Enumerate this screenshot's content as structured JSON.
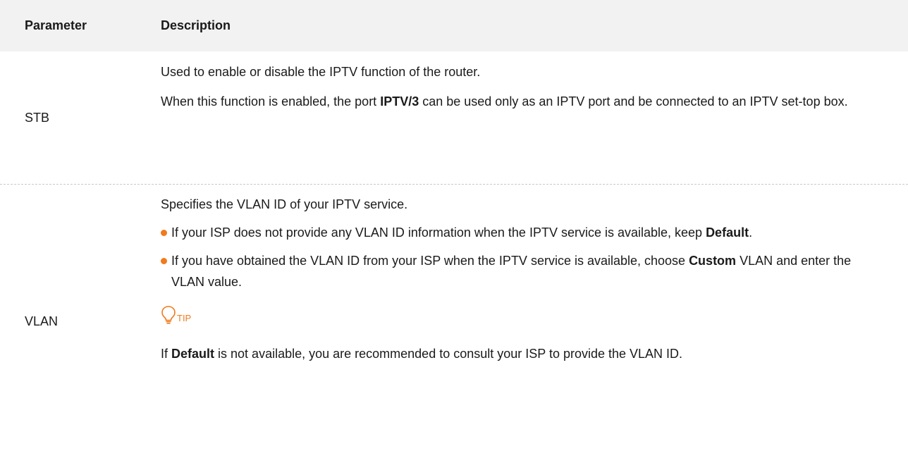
{
  "table": {
    "header": {
      "parameter": "Parameter",
      "description": "Description"
    },
    "rows": [
      {
        "param": "STB",
        "desc_line1": "Used to enable or disable the IPTV function of the router.",
        "desc_line2_pre": "When this function is enabled, the port ",
        "desc_line2_bold": "IPTV/3",
        "desc_line2_post": " can be used only as an IPTV port and be connected to an IPTV set-top box."
      },
      {
        "param": "VLAN",
        "desc_line1": "Specifies the VLAN ID of your IPTV service.",
        "bullet1_pre": "If your ISP does not provide any VLAN ID information when the IPTV service is available, keep ",
        "bullet1_bold": "Default",
        "bullet1_post": ".",
        "bullet2_pre": "If you have obtained the VLAN ID from your ISP when the IPTV service is available, choose ",
        "bullet2_bold": "Custom",
        "bullet2_post": " VLAN and enter the VLAN value.",
        "tip_label": "TIP",
        "tip_pre": "If ",
        "tip_bold": "Default",
        "tip_post": " is not available, you are recommended to consult your ISP to provide the VLAN ID."
      }
    ]
  },
  "colors": {
    "accent": "#f07a1c",
    "header_bg": "#f2f2f2",
    "divider": "#c8c8c8"
  }
}
